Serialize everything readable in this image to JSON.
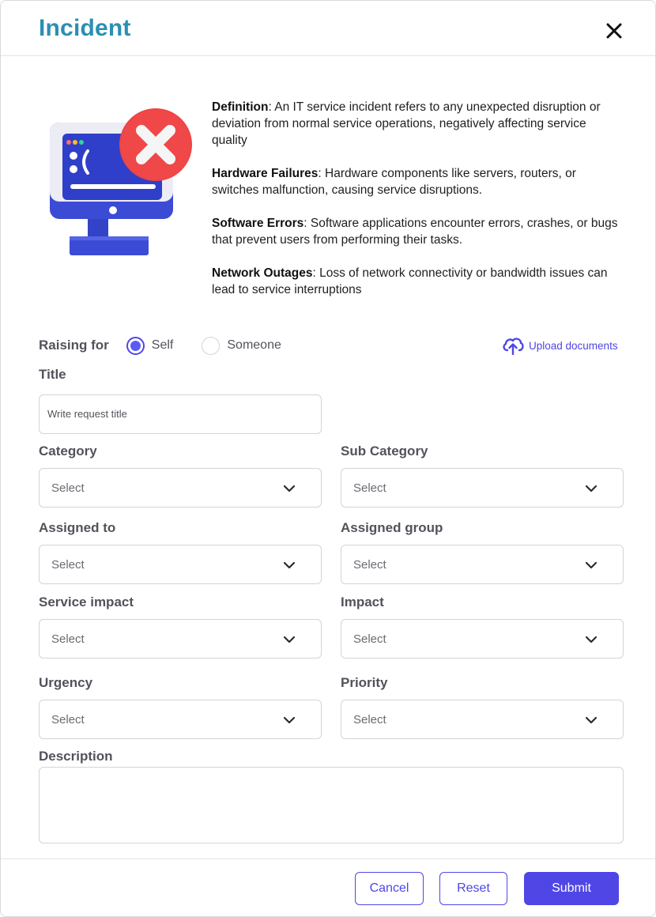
{
  "dialog": {
    "title": "Incident"
  },
  "icons": {
    "close": "close-icon",
    "upload": "upload-cloud-icon",
    "chevron": "chevron-down-icon",
    "illustration": "monitor-error-illustration"
  },
  "colors": {
    "title": "#2b8fb2",
    "accent": "#4f46e5",
    "error_badge": "#ef4444",
    "monitor": "#3b4bd6"
  },
  "definitions": [
    {
      "term": "Definition",
      "text": ": An IT service incident refers to any unexpected disruption or deviation from normal service operations, negatively affecting service quality"
    },
    {
      "term": "Hardware Failures",
      "text": ": Hardware components like servers, routers, or switches malfunction, causing service disruptions."
    },
    {
      "term": "Software Errors",
      "text": ": Software applications encounter errors, crashes, or bugs that prevent users from performing their tasks."
    },
    {
      "term": "Network Outages",
      "text": ": Loss of network connectivity or bandwidth issues can lead to service interruptions"
    }
  ],
  "raising_for": {
    "label": "Raising for",
    "options": [
      "Self",
      "Someone"
    ],
    "selected": "Self"
  },
  "upload": {
    "label": "Upload documents"
  },
  "form": {
    "title": {
      "label": "Title",
      "placeholder": "Write request title"
    },
    "category": {
      "label": "Category",
      "value": "Select"
    },
    "sub_category": {
      "label": "Sub Category",
      "value": "Select"
    },
    "assigned_to": {
      "label": "Assigned to",
      "value": "Select"
    },
    "assigned_group": {
      "label": "Assigned group",
      "value": "Select"
    },
    "service_impact": {
      "label": "Service impact",
      "value": "Select"
    },
    "impact": {
      "label": "Impact",
      "value": "Select"
    },
    "urgency": {
      "label": "Urgency",
      "value": "Select"
    },
    "priority": {
      "label": "Priority",
      "value": "Select"
    },
    "description": {
      "label": "Description",
      "value": ""
    }
  },
  "actions": {
    "cancel": "Cancel",
    "reset": "Reset",
    "submit": "Submit"
  }
}
